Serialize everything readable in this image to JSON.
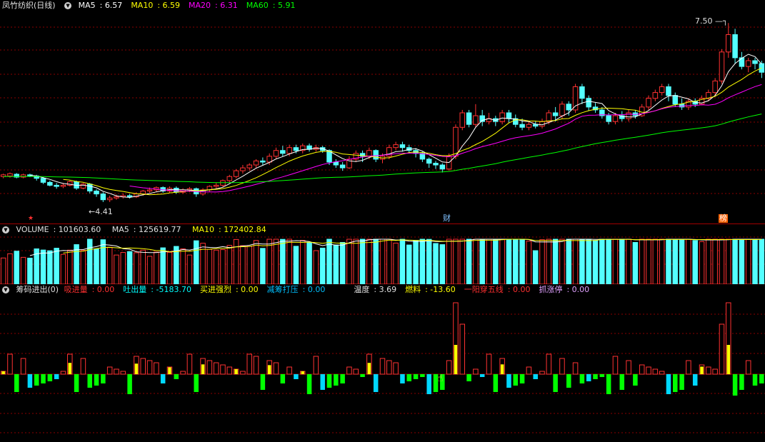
{
  "main": {
    "title": "凤竹纺织(日线)",
    "ma": [
      {
        "label": "MA5",
        "value": "6.57",
        "color": "#ffffff"
      },
      {
        "label": "MA10",
        "value": "6.59",
        "color": "#ffff00"
      },
      {
        "label": "MA20",
        "value": "6.31",
        "color": "#ff00ff"
      },
      {
        "label": "MA60",
        "value": "5.91",
        "color": "#00ff00"
      }
    ],
    "high_label": "7.50",
    "low_label": "4.41",
    "badges": [
      {
        "text": "★",
        "color": "#ff3030",
        "bg": "transparent"
      },
      {
        "text": "财",
        "color": "#80c0ff",
        "bg": "transparent"
      },
      {
        "text": "榜",
        "color": "#ffffff",
        "bg": "#ff6000"
      }
    ]
  },
  "volume": {
    "title": "VOLUME",
    "value": "101603.60",
    "ma5_label": "MA5",
    "ma5": "125619.77",
    "ma10_label": "MA10",
    "ma10": "172402.84"
  },
  "indicator": {
    "title": "筹码进出(0)",
    "items": [
      {
        "label": "吸进量",
        "value": "0.00",
        "color": "#ff3030"
      },
      {
        "label": "吐出量",
        "value": "-5183.70",
        "color": "#00ffff"
      },
      {
        "label": "买进强烈",
        "value": "0.00",
        "color": "#ffff00"
      },
      {
        "label": "减筹打压",
        "value": "0.00",
        "color": "#00c0ff"
      },
      {
        "label": "温度",
        "value": "3.69",
        "color": "#e0e0e0"
      },
      {
        "label": "燃料",
        "value": "-13.60",
        "color": "#ffff00"
      },
      {
        "label": "一阳穿五线",
        "value": "0.00",
        "color": "#ff3030"
      },
      {
        "label": "抓涨停",
        "value": "0.00",
        "color": "#e0a0ff"
      }
    ]
  },
  "colors": {
    "up": "#ff3232",
    "down": "#54ffff",
    "grid": "#8a0000"
  },
  "chart_data": {
    "type": "candlestick",
    "price_range": [
      4.2,
      7.7
    ],
    "candles": [
      [
        4.85,
        4.88,
        4.82,
        4.9
      ],
      [
        4.86,
        4.9,
        4.83,
        4.92
      ],
      [
        4.89,
        4.84,
        4.82,
        4.91
      ],
      [
        4.84,
        4.88,
        4.82,
        4.9
      ],
      [
        4.88,
        4.86,
        4.84,
        4.9
      ],
      [
        4.86,
        4.82,
        4.78,
        4.88
      ],
      [
        4.82,
        4.75,
        4.72,
        4.84
      ],
      [
        4.75,
        4.7,
        4.68,
        4.78
      ],
      [
        4.7,
        4.68,
        4.64,
        4.74
      ],
      [
        4.68,
        4.7,
        4.65,
        4.74
      ],
      [
        4.7,
        4.76,
        4.68,
        4.78
      ],
      [
        4.76,
        4.65,
        4.62,
        4.78
      ],
      [
        4.65,
        4.72,
        4.63,
        4.74
      ],
      [
        4.72,
        4.6,
        4.56,
        4.74
      ],
      [
        4.6,
        4.55,
        4.5,
        4.63
      ],
      [
        4.55,
        4.45,
        4.41,
        4.58
      ],
      [
        4.45,
        4.48,
        4.41,
        4.52
      ],
      [
        4.48,
        4.5,
        4.45,
        4.54
      ],
      [
        4.5,
        4.52,
        4.47,
        4.56
      ],
      [
        4.52,
        4.5,
        4.47,
        4.55
      ],
      [
        4.5,
        4.55,
        4.48,
        4.58
      ],
      [
        4.55,
        4.6,
        4.52,
        4.62
      ],
      [
        4.6,
        4.62,
        4.57,
        4.66
      ],
      [
        4.62,
        4.66,
        4.58,
        4.68
      ],
      [
        4.66,
        4.6,
        4.57,
        4.68
      ],
      [
        4.6,
        4.65,
        4.57,
        4.68
      ],
      [
        4.65,
        4.58,
        4.55,
        4.68
      ],
      [
        4.58,
        4.62,
        4.55,
        4.65
      ],
      [
        4.62,
        4.64,
        4.58,
        4.67
      ],
      [
        4.64,
        4.55,
        4.5,
        4.66
      ],
      [
        4.55,
        4.62,
        4.52,
        4.65
      ],
      [
        4.62,
        4.68,
        4.58,
        4.7
      ],
      [
        4.68,
        4.7,
        4.64,
        4.74
      ],
      [
        4.7,
        4.78,
        4.67,
        4.8
      ],
      [
        4.78,
        4.85,
        4.74,
        4.88
      ],
      [
        4.85,
        4.95,
        4.82,
        4.98
      ],
      [
        4.95,
        5.0,
        4.9,
        5.05
      ],
      [
        5.0,
        5.05,
        4.95,
        5.08
      ],
      [
        5.05,
        5.12,
        5.0,
        5.15
      ],
      [
        5.12,
        5.1,
        5.05,
        5.18
      ],
      [
        5.1,
        5.2,
        5.05,
        5.25
      ],
      [
        5.2,
        5.3,
        5.15,
        5.35
      ],
      [
        5.3,
        5.25,
        5.2,
        5.38
      ],
      [
        5.25,
        5.35,
        5.2,
        5.4
      ],
      [
        5.35,
        5.3,
        5.25,
        5.4
      ],
      [
        5.3,
        5.38,
        5.25,
        5.42
      ],
      [
        5.38,
        5.32,
        5.28,
        5.42
      ],
      [
        5.32,
        5.35,
        5.28,
        5.4
      ],
      [
        5.35,
        5.3,
        5.26,
        5.38
      ],
      [
        5.3,
        5.1,
        5.05,
        5.32
      ],
      [
        5.1,
        5.05,
        5.0,
        5.15
      ],
      [
        5.05,
        5.0,
        4.95,
        5.1
      ],
      [
        5.0,
        5.15,
        4.98,
        5.2
      ],
      [
        5.15,
        5.25,
        5.1,
        5.3
      ],
      [
        5.25,
        5.2,
        5.1,
        5.3
      ],
      [
        5.2,
        5.3,
        5.15,
        5.35
      ],
      [
        5.3,
        5.15,
        5.1,
        5.32
      ],
      [
        5.15,
        5.2,
        5.08,
        5.25
      ],
      [
        5.2,
        5.35,
        5.15,
        5.4
      ],
      [
        5.35,
        5.4,
        5.3,
        5.45
      ],
      [
        5.4,
        5.35,
        5.28,
        5.45
      ],
      [
        5.35,
        5.3,
        5.25,
        5.4
      ],
      [
        5.3,
        5.25,
        5.18,
        5.34
      ],
      [
        5.25,
        5.15,
        5.1,
        5.28
      ],
      [
        5.15,
        5.08,
        5.0,
        5.18
      ],
      [
        5.08,
        5.05,
        4.98,
        5.12
      ],
      [
        5.05,
        4.98,
        4.92,
        5.08
      ],
      [
        4.98,
        5.2,
        4.95,
        5.25
      ],
      [
        5.2,
        5.7,
        5.15,
        5.75
      ],
      [
        5.7,
        5.95,
        5.65,
        6.0
      ],
      [
        5.95,
        5.75,
        5.7,
        6.0
      ],
      [
        5.75,
        5.9,
        5.7,
        6.1
      ],
      [
        5.9,
        5.8,
        5.72,
        6.0
      ],
      [
        5.8,
        5.85,
        5.75,
        5.95
      ],
      [
        5.85,
        5.8,
        5.72,
        5.9
      ],
      [
        5.8,
        5.95,
        5.75,
        6.0
      ],
      [
        5.95,
        5.85,
        5.78,
        6.0
      ],
      [
        5.85,
        5.75,
        5.7,
        5.92
      ],
      [
        5.75,
        5.7,
        5.65,
        5.85
      ],
      [
        5.7,
        5.75,
        5.65,
        5.8
      ],
      [
        5.75,
        5.72,
        5.68,
        5.8
      ],
      [
        5.72,
        5.8,
        5.68,
        5.85
      ],
      [
        5.8,
        5.95,
        5.75,
        6.0
      ],
      [
        5.95,
        5.9,
        5.8,
        6.05
      ],
      [
        5.9,
        6.1,
        5.85,
        6.15
      ],
      [
        6.1,
        6.0,
        5.9,
        6.15
      ],
      [
        6.0,
        6.4,
        5.95,
        6.45
      ],
      [
        6.4,
        6.2,
        6.1,
        6.45
      ],
      [
        6.2,
        6.05,
        5.98,
        6.25
      ],
      [
        6.05,
        6.0,
        5.95,
        6.12
      ],
      [
        6.0,
        5.9,
        5.85,
        6.05
      ],
      [
        5.9,
        5.8,
        5.75,
        5.95
      ],
      [
        5.8,
        5.9,
        5.75,
        5.95
      ],
      [
        5.9,
        5.85,
        5.8,
        5.98
      ],
      [
        5.85,
        5.95,
        5.8,
        6.0
      ],
      [
        5.95,
        5.9,
        5.85,
        6.0
      ],
      [
        5.9,
        6.05,
        5.88,
        6.1
      ],
      [
        6.05,
        6.2,
        6.0,
        6.25
      ],
      [
        6.2,
        6.3,
        6.15,
        6.35
      ],
      [
        6.3,
        6.4,
        6.25,
        6.45
      ],
      [
        6.4,
        6.25,
        6.15,
        6.45
      ],
      [
        6.25,
        6.1,
        6.05,
        6.3
      ],
      [
        6.1,
        6.05,
        6.0,
        6.2
      ],
      [
        6.05,
        6.15,
        6.0,
        6.2
      ],
      [
        6.15,
        6.1,
        6.05,
        6.2
      ],
      [
        6.1,
        6.2,
        6.08,
        6.25
      ],
      [
        6.2,
        6.3,
        6.15,
        6.35
      ],
      [
        6.3,
        6.5,
        6.25,
        6.55
      ],
      [
        6.5,
        7.0,
        6.45,
        7.05
      ],
      [
        7.0,
        7.3,
        6.9,
        7.5
      ],
      [
        7.3,
        6.9,
        6.8,
        7.4
      ],
      [
        6.9,
        6.75,
        6.7,
        7.0
      ],
      [
        6.75,
        6.85,
        6.65,
        6.9
      ],
      [
        6.85,
        6.8,
        6.7,
        6.9
      ],
      [
        6.8,
        6.65,
        6.55,
        6.85
      ]
    ]
  }
}
